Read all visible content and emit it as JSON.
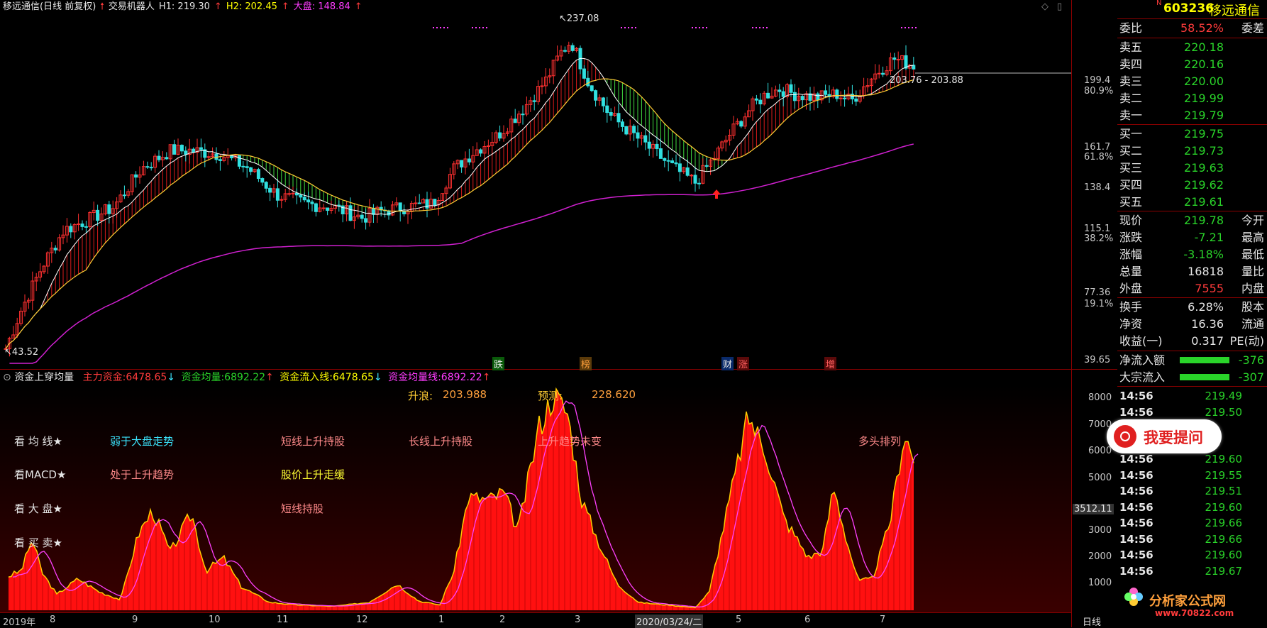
{
  "header": {
    "title": "移远通信(日线 前复权)",
    "robot": "交易机器人",
    "h1": "H1: 219.30",
    "h2": "H2: 202.45",
    "dapan": "大盘: 148.84"
  },
  "price_axis": {
    "labels": [
      "199.4",
      "80.9%",
      "161.7",
      "61.8%",
      "138.4",
      "115.1",
      "38.2%",
      "77.36",
      "19.1%",
      "39.65"
    ]
  },
  "annotations": {
    "high": "237.08",
    "low": "43.52",
    "range": "203.76 - 203.88"
  },
  "event_tags": [
    "跌",
    "榜",
    "财",
    "涨",
    "增"
  ],
  "indicator_header": {
    "name": "资金上穿均量",
    "zhuli_label": "主力资金:",
    "zhuli_val": "6478.65",
    "junliang_label": "资金均量:",
    "junliang_val": "6892.22",
    "liuru_label": "资金流入线:",
    "liuru_val": "6478.65",
    "junliangxian_label": "资金均量线:",
    "junliangxian_val": "6892.22"
  },
  "indicator_text": {
    "shenglang_label": "升浪:",
    "shenglang_val": "203.988",
    "yuce_label": "预测:",
    "yuce_val": "228.620",
    "btn1": "看 均 线★",
    "btn2": "看MACD★",
    "btn3": "看 大 盘★",
    "btn4": "看 买 卖★",
    "t1": "弱于大盘走势",
    "t2": "短线上升持股",
    "t3": "长线上升持股",
    "t4": "上升趋势未变",
    "t5": "多头排列",
    "t6": "处于上升趋势",
    "t7": "股价上升走缓",
    "t8": "短线持股"
  },
  "ind_axis": {
    "labels": [
      "8000",
      "7000",
      "6000",
      "5000",
      "3512.11",
      "3000",
      "2000",
      "1000"
    ]
  },
  "date_axis": {
    "labels": [
      "2019年",
      "8",
      "9",
      "10",
      "11",
      "12",
      "1",
      "2",
      "3",
      "2020/03/24/二",
      "5",
      "6",
      "7"
    ],
    "period": "日线"
  },
  "quote": {
    "code": "603236",
    "name": "移远通信",
    "weibi_label": "委比",
    "weibi_val": "58.52%",
    "weicha_label": "委差",
    "sell": [
      {
        "label": "卖五",
        "price": "220.18"
      },
      {
        "label": "卖四",
        "price": "220.16"
      },
      {
        "label": "卖三",
        "price": "220.00"
      },
      {
        "label": "卖二",
        "price": "219.99"
      },
      {
        "label": "卖一",
        "price": "219.79"
      }
    ],
    "buy": [
      {
        "label": "买一",
        "price": "219.75"
      },
      {
        "label": "买二",
        "price": "219.73"
      },
      {
        "label": "买三",
        "price": "219.63"
      },
      {
        "label": "买四",
        "price": "219.62"
      },
      {
        "label": "买五",
        "price": "219.61"
      }
    ],
    "stats": [
      {
        "label": "现价",
        "val": "219.78",
        "label2": "今开",
        "color": "#2ad42a"
      },
      {
        "label": "涨跌",
        "val": "-7.21",
        "label2": "最高",
        "color": "#2ad42a"
      },
      {
        "label": "涨幅",
        "val": "-3.18%",
        "label2": "最低",
        "color": "#2ad42a"
      },
      {
        "label": "总量",
        "val": "16818",
        "label2": "量比",
        "color": "#e6e6e6"
      },
      {
        "label": "外盘",
        "val": "7555",
        "label2": "内盘",
        "color": "#ff3b3b"
      }
    ],
    "stats2": [
      {
        "label": "换手",
        "val": "6.28%",
        "label2": "股本"
      },
      {
        "label": "净资",
        "val": "16.36",
        "label2": "流通"
      },
      {
        "label": "收益(一)",
        "val": "0.317",
        "label2": "PE(动)"
      }
    ],
    "flow": [
      {
        "label": "净流入额",
        "val": "-376"
      },
      {
        "label": "大宗流入",
        "val": "-307"
      }
    ],
    "ticks": [
      {
        "time": "14:56",
        "price": "219.49"
      },
      {
        "time": "14:56",
        "price": "219.50"
      },
      {
        "time": "14:56",
        "price": "219.60"
      },
      {
        "time": "14:56",
        "price": "219.55"
      },
      {
        "time": "14:56",
        "price": "219.51"
      },
      {
        "time": "14:56",
        "price": "219.60"
      },
      {
        "time": "14:56",
        "price": "219.66"
      },
      {
        "time": "14:56",
        "price": "219.66"
      },
      {
        "time": "14:56",
        "price": "219.60"
      },
      {
        "time": "14:56",
        "price": "219.67"
      }
    ],
    "ask_button": "我要提问",
    "watermark": "分析家公式网",
    "watermark_url": "www.70822.com"
  }
}
